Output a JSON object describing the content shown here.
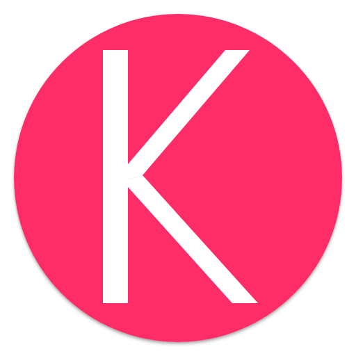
{
  "icon": {
    "name": "k-logo-icon",
    "letter": "K",
    "background_color": "#ff2d67",
    "glyph_color": "#ffffff"
  }
}
